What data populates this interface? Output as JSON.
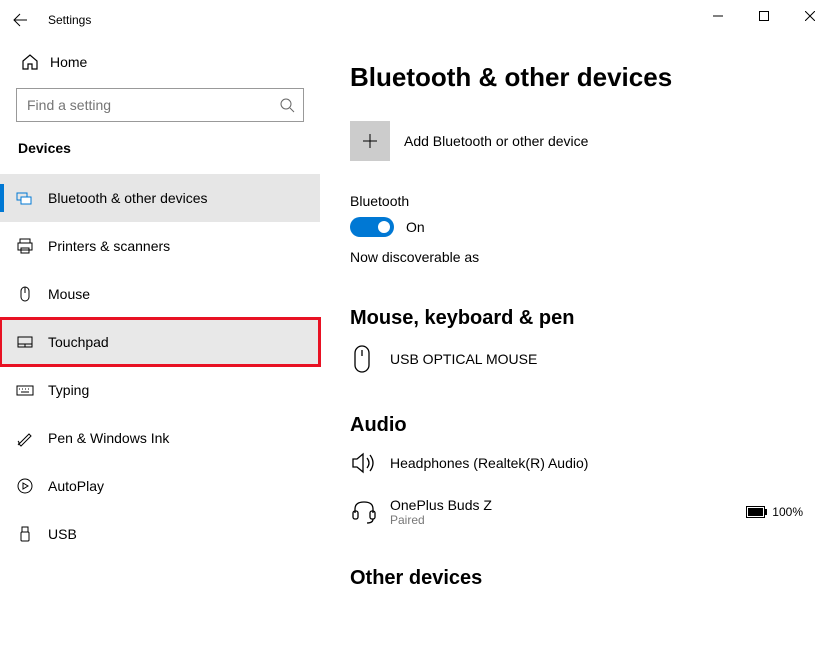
{
  "app": {
    "title": "Settings"
  },
  "sidebar": {
    "home": "Home",
    "search_placeholder": "Find a setting",
    "section": "Devices",
    "items": [
      {
        "label": "Bluetooth & other devices"
      },
      {
        "label": "Printers & scanners"
      },
      {
        "label": "Mouse"
      },
      {
        "label": "Touchpad"
      },
      {
        "label": "Typing"
      },
      {
        "label": "Pen & Windows Ink"
      },
      {
        "label": "AutoPlay"
      },
      {
        "label": "USB"
      }
    ]
  },
  "main": {
    "title": "Bluetooth & other devices",
    "add_label": "Add Bluetooth or other device",
    "bt_label": "Bluetooth",
    "bt_state": "On",
    "discoverable": "Now discoverable as",
    "group_mouse": "Mouse, keyboard & pen",
    "mouse_device": "USB OPTICAL MOUSE",
    "group_audio": "Audio",
    "audio1_name": "Headphones (Realtek(R) Audio)",
    "audio2_name": "OnePlus Buds Z",
    "audio2_status": "Paired",
    "audio2_battery": "100%",
    "group_other": "Other devices"
  }
}
